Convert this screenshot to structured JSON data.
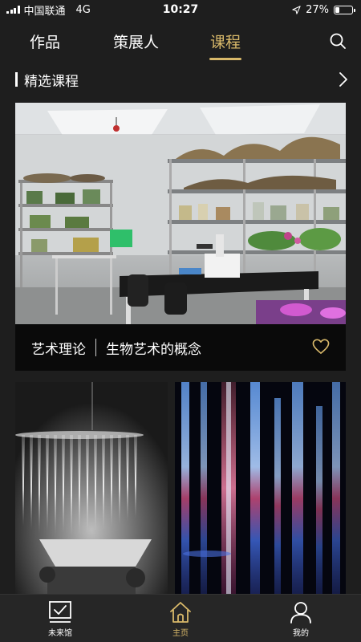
{
  "status_bar": {
    "carrier": "中国联通",
    "network": "4G",
    "time": "10:27",
    "battery": "27%",
    "battery_level": 0.27
  },
  "top_nav": {
    "tabs": [
      {
        "label": "作品",
        "active": false
      },
      {
        "label": "策展人",
        "active": false
      },
      {
        "label": "课程",
        "active": true
      }
    ],
    "accent_color": "#d9b96a"
  },
  "section": {
    "title": "精选课程"
  },
  "featured_course": {
    "category": "艺术理论",
    "title": "生物艺术的概念"
  },
  "bottom_tabs": [
    {
      "label": "未来馆",
      "icon": "checkbox-icon",
      "active": false
    },
    {
      "label": "主页",
      "icon": "home-icon",
      "active": true
    },
    {
      "label": "我的",
      "icon": "person-icon",
      "active": false
    }
  ]
}
